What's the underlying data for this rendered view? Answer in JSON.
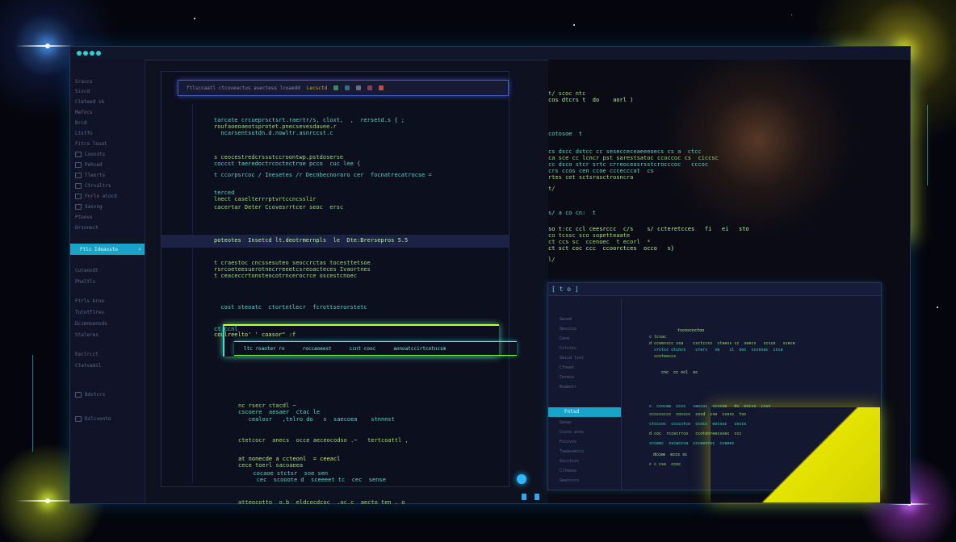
{
  "colors": {
    "accent_cyan": "#1aa3c8",
    "neon_yellow": "#f5f010",
    "neon_green": "#c8ff30",
    "code_green": "#9bdc6a",
    "code_teal": "#4fd6c8",
    "background": "#05060d"
  },
  "sidebar": {
    "active_label": "Ftlc Ideaxsto",
    "items": [
      "Sravcs",
      "Sivcd",
      "Cleteed sk",
      "Mefocs",
      "Brcd",
      "Ltstfo",
      "Fitcs lsuat",
      "Coonsts",
      "Pehced",
      "Tleorts",
      "Ctrvaltrs",
      "Fnrlo alocd",
      "Sasvng",
      "Ptoovs",
      "Orsonect",
      "Cutaoodt",
      "Phaltls",
      "Ftrls kroe",
      "Tutotflres",
      "Dcimnoenods",
      "Staleres",
      "Eeclrcct",
      "Ctatvamil",
      "Bdvtcrs",
      "Dslcvonto"
    ]
  },
  "editor": {
    "toolbar_text": "ftlsccaatl  ctcoveactus  asectess  lcoaedd",
    "toolbar_label": "Lecsctd",
    "code_lines": [
      {
        "text": "tarcate crcueprsctsrt.raertr/s, cloxt,  ,  rersetd.s { ;",
        "color": "#4fd6c8"
      },
      {
        "text": "roufaoeoaeotsprotet.pnecsevesdauee.r",
        "color": "#9bdc6a"
      },
      {
        "text": "  ncarsentsotdn.d.nowltr.asnrccst.c",
        "color": "#4fd6c8"
      },
      {
        "text": "s ceocestredcrssutccroontwp.pstdoserse",
        "color": "#9bdc6a"
      },
      {
        "text": "coccst taeredoctrcoctnctroe pcco  cuc lee {",
        "color": "#4fd6c8"
      },
      {
        "text": "t ccorpsrcoc / Inesetes /r Decnbecnoraro cer  focnatrecatrocse =",
        "color": "#4fd6c8"
      },
      {
        "text": "terced",
        "color": "#4fd6c8"
      },
      {
        "text": "lnect caselterrrptvrtccncsslir",
        "color": "#9bdc6a"
      },
      {
        "text": "cacertar Deter Ccovesrrtcer seoc  ersc",
        "color": "#9bdc6a"
      },
      {
        "text": "poteotes  Insetcd lt.deotrmernpls  le  Dte:Brersepros 5.5",
        "color": "#b8f0a0"
      },
      {
        "text": "t craestoc cncssesuteo seoccrctas tocesttetsoe",
        "color": "#9bdc6a"
      },
      {
        "text": "rsrcoeteesuerotnecrreeetcsreoacteces Ivaortnes",
        "color": "#9bdc6a"
      },
      {
        "text": "t ceaceccrtonsteocotrncerocrce oscestcnoec",
        "color": "#9bdc6a"
      },
      {
        "text": "  cost steoatc  ctortntlecr  fcrottserorstetc",
        "color": "#4fd6c8"
      },
      {
        "text": "ct ccnl",
        "color": "#4fd6c8"
      },
      {
        "text": "coulreelto' ' coasor\" :f",
        "color": "#c8e87a"
      },
      {
        "text": "nc rsecr ctacdl ~",
        "color": "#9bdc6a"
      },
      {
        "text": "cscoere  aesaer  ctac le",
        "color": "#4fd6c8"
      },
      {
        "text": "   cealosr   ,tnlro do   s  saecoea    stnnnst",
        "color": "#4fd6c8"
      },
      {
        "text": "ctetcocr  anecs  occe aeceocodso .~   tertcoattl ,",
        "color": "#9bdc6a"
      },
      {
        "text": "at nonecde a ccteonl  = ceeacl",
        "color": "#c8e87a"
      },
      {
        "text": "cece toerl sacoaeea",
        "color": "#9bdc6a"
      },
      {
        "text": "  cocaoe stctsr  soe sen",
        "color": "#4fd6c8"
      },
      {
        "text": "   cec  scooote d  sceeeet tc  cec  sense",
        "color": "#4fd6c8"
      },
      {
        "text": "atteocotto  o.b  eldcocdcoc  .oc.c  aecto ten . o",
        "color": "#9bdc6a"
      }
    ],
    "neon_labels": [
      "ltc  roaoter ro",
      "roccaoeest",
      "ccnt  cooc",
      "aonoatccirtcotncsm"
    ]
  },
  "right_panel": {
    "lines": [
      {
        "text": "t/ scoc ntc",
        "color": "#9bdc6a"
      },
      {
        "text": "cos dtcrs t  do    aorl )",
        "color": "#b8f0a0"
      },
      {
        "text": "cotosoe  t",
        "color": "#4fd6c8"
      },
      {
        "text": "cs dscc dstcc cc sesecceceaeeeoecs cs a  ctcc",
        "color": "#4fd6c8"
      },
      {
        "text": "ca sce cc lcncr pst sarestsatoc ccoccoc cs  ciccsc",
        "color": "#9bdc6a"
      },
      {
        "text": "cc dsco stcr srtc crreoceosrsstcrocccoc   cccoc",
        "color": "#4fd6c8"
      },
      {
        "text": "crs ccos cen ccoe cccecccat  cs",
        "color": "#4fd6c8"
      },
      {
        "text": "rtes cet sctsrasctrosncra",
        "color": "#9bdc6a"
      },
      {
        "text": "t/",
        "color": "#9bdc6a"
      },
      {
        "text": "s/ a co cn:  t",
        "color": "#4fd6c8"
      },
      {
        "text": "so t:cc ccl ceesrccc  c/s    s/ ccteretcces   fi   ei   sto",
        "color": "#b8f0a0"
      },
      {
        "text": "co tcssc sco sopetteaate",
        "color": "#9bdc6a"
      },
      {
        "text": "ct ccs sc  ccenoec  t ecorl  *",
        "color": "#9bdc6a"
      },
      {
        "text": "ct sct coc ccc  ccoorctces  occo   s}",
        "color": "#b8f0a0"
      },
      {
        "text": "l/",
        "color": "#9bdc6a"
      }
    ]
  },
  "sub_window": {
    "title": "[ t o ]",
    "active_item": "Fntsd",
    "items": [
      "Sesed",
      "Sesccss",
      "Cece",
      "Crtctsc",
      "Seicd lsvt",
      "Cfovet",
      "Cerecs",
      "Rsaeotr",
      "Fntsd",
      "Sesac",
      "Ccsto aroc",
      "Fcccvos",
      "Toeacoeccs",
      "Sscctcsc",
      "Clfeoos",
      "Seatcccs"
    ],
    "code_lines": [
      {
        "text": "tscoscoctoo",
        "color": "#b8f0a0"
      },
      {
        "text": "c tcsac",
        "color": "#9bdc6a"
      },
      {
        "text": "d ccoesscc ssa    csctccss  ctaess cc  oeecs   sccce   ssece",
        "color": "#9bdc6a"
      },
      {
        "text": "  crctsc ctcncs    crerc   se    cl  ooc  cccosac  ccca",
        "color": "#4fd6c8"
      },
      {
        "text": "  ccoteeccs",
        "color": "#9bdc6a"
      },
      {
        "text": "cnc  cc ocl  oc",
        "color": "#b8f0a0"
      },
      {
        "text": "c  ccocee  ccss   ceococ  scccoe   dc  eocss  ccoc",
        "color": "#4fd6c8"
      },
      {
        "text": "cccccsccs  cocccs  cocd  cse  ccesc  toc",
        "color": "#9bdc6a"
      },
      {
        "text": "ctcccoc  ccccctco  ccocc  eocsoc   cnccs",
        "color": "#4fd6c8"
      },
      {
        "text": "d coc  rccecrrco   ccotenreecsoec  ccc",
        "color": "#9bdc6a"
      },
      {
        "text": "ccceec  sscaccca  ccceeocsc  cceeoc",
        "color": "#4fd6c8"
      },
      {
        "text": "dccee  eccs sc",
        "color": "#b8f0a0"
      },
      {
        "text": "c c cse  ccoc",
        "color": "#9bdc6a"
      }
    ]
  }
}
